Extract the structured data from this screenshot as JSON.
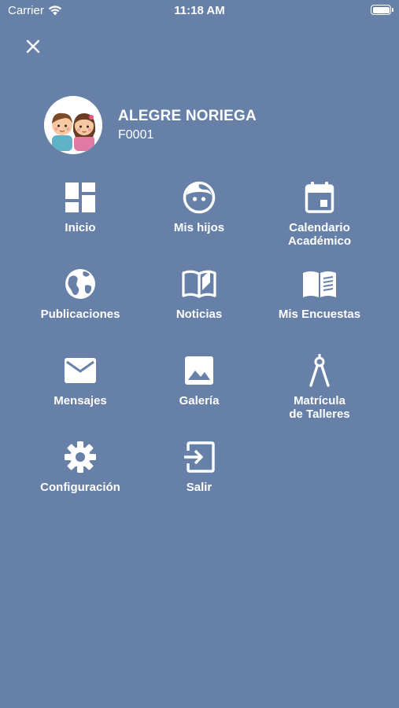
{
  "status_bar": {
    "carrier": "Carrier",
    "time": "11:18 AM",
    "wifi_icon": "wifi-icon",
    "battery_icon": "battery-icon"
  },
  "header": {
    "close_icon": "close-icon"
  },
  "profile": {
    "name": "ALEGRE NORIEGA",
    "code": "F0001",
    "avatar_icon": "children-avatar"
  },
  "menu": {
    "items": [
      {
        "label": "Inicio",
        "icon": "dashboard-icon"
      },
      {
        "label": "Mis hijos",
        "icon": "child-face-icon"
      },
      {
        "label": "Calendario\nAcadémico",
        "icon": "calendar-icon"
      },
      {
        "label": "Publicaciones",
        "icon": "globe-icon"
      },
      {
        "label": "Noticias",
        "icon": "open-book-icon"
      },
      {
        "label": "Mis Encuestas",
        "icon": "book-lines-icon"
      },
      {
        "label": "Mensajes",
        "icon": "mail-icon"
      },
      {
        "label": "Galería",
        "icon": "image-icon"
      },
      {
        "label": "Matrícula\nde Talleres",
        "icon": "compass-icon"
      },
      {
        "label": "Configuración",
        "icon": "gear-icon"
      },
      {
        "label": "Salir",
        "icon": "logout-icon"
      }
    ]
  },
  "colors": {
    "background": "#6680a8",
    "foreground": "#ffffff"
  }
}
